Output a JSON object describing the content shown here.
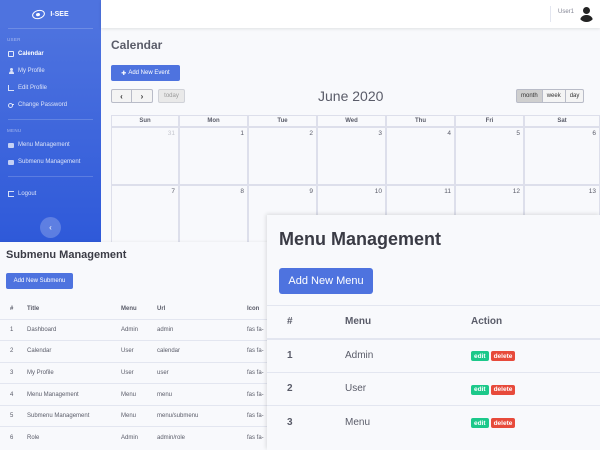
{
  "app": {
    "brand": "I-SEE",
    "user_name": "User1"
  },
  "sidebar": {
    "heading_user": "USER",
    "heading_menu": "MENU",
    "items_user": [
      {
        "label": "Calendar",
        "icon": "calendar-icon",
        "active": true
      },
      {
        "label": "My Profile",
        "icon": "user-icon"
      },
      {
        "label": "Edit Profile",
        "icon": "edit-icon"
      },
      {
        "label": "Change Password",
        "icon": "key-icon"
      }
    ],
    "items_menu": [
      {
        "label": "Menu Management",
        "icon": "folder-icon"
      },
      {
        "label": "Submenu Management",
        "icon": "folder-icon"
      }
    ],
    "logout": "Logout",
    "toggle_icon": "‹"
  },
  "calendar": {
    "page_title": "Calendar",
    "add_event_label": "Add New Event",
    "prev_icon": "‹",
    "next_icon": "›",
    "today_label": "today",
    "month_title": "June 2020",
    "views": [
      "month",
      "week",
      "day"
    ],
    "active_view": "month",
    "weekdays": [
      "Sun",
      "Mon",
      "Tue",
      "Wed",
      "Thu",
      "Fri",
      "Sat"
    ],
    "weeks": [
      [
        "31",
        "1",
        "2",
        "3",
        "4",
        "5",
        "6"
      ],
      [
        "7",
        "8",
        "9",
        "10",
        "11",
        "12",
        "13"
      ]
    ]
  },
  "submenu": {
    "title": "Submenu Management",
    "add_label": "Add New Submenu",
    "columns": [
      "#",
      "Title",
      "Menu",
      "Url",
      "Icon"
    ],
    "rows": [
      [
        "1",
        "Dashboard",
        "Admin",
        "admin",
        "fas fa-"
      ],
      [
        "2",
        "Calendar",
        "User",
        "calendar",
        "fas fa-"
      ],
      [
        "3",
        "My Profile",
        "User",
        "user",
        "fas fa-"
      ],
      [
        "4",
        "Menu Management",
        "Menu",
        "menu",
        "fas fa-"
      ],
      [
        "5",
        "Submenu Management",
        "Menu",
        "menu/submenu",
        "fas fa-"
      ],
      [
        "6",
        "Role",
        "Admin",
        "admin/role",
        "fas fa-"
      ]
    ]
  },
  "menu": {
    "title": "Menu Management",
    "add_label": "Add New Menu",
    "columns": [
      "#",
      "Menu",
      "Action"
    ],
    "rows": [
      [
        "1",
        "Admin"
      ],
      [
        "2",
        "User"
      ],
      [
        "3",
        "Menu"
      ]
    ],
    "edit_label": "edit",
    "delete_label": "delete"
  },
  "colors": {
    "primary": "#4e73df",
    "success": "#1cc88a",
    "danger": "#e74a3b"
  }
}
